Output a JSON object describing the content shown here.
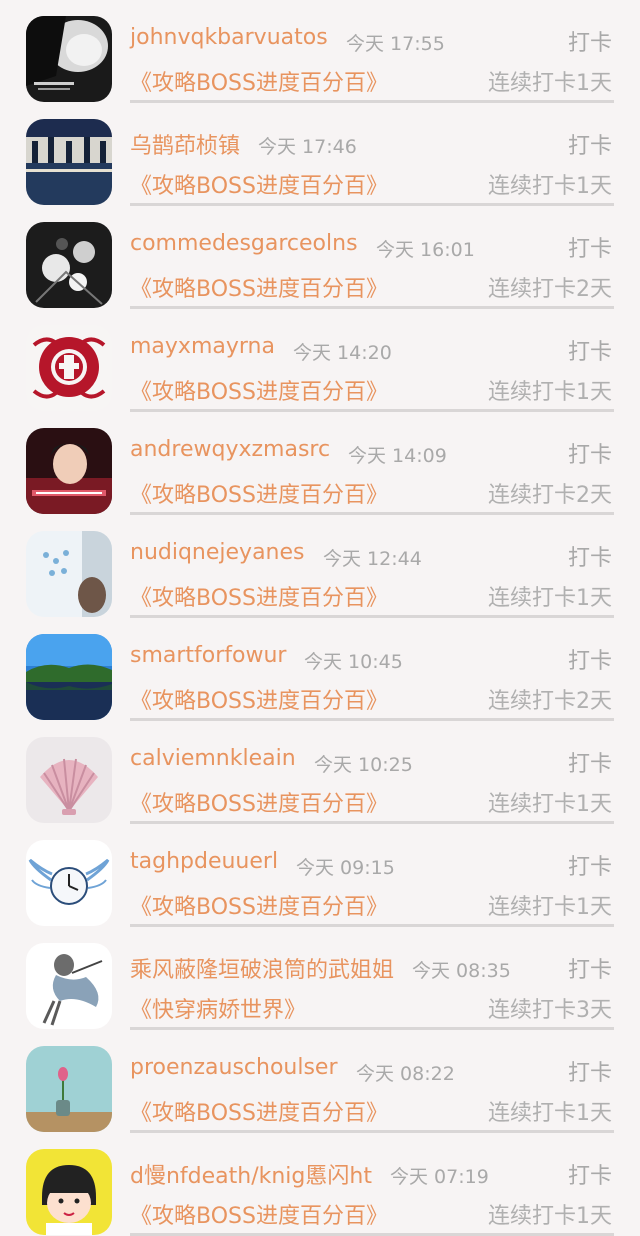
{
  "entries": [
    {
      "username": "johnvqkbarvuatos",
      "time": "今天 17:55",
      "action": "打卡",
      "book": "《攻略BOSS进度百分百》",
      "streak": "连续打卡1天",
      "avatar": "bw-portrait"
    },
    {
      "username": "乌鹊茚桢镇",
      "time": "今天 17:46",
      "action": "打卡",
      "book": "《攻略BOSS进度百分百》",
      "streak": "连续打卡1天",
      "avatar": "dancers"
    },
    {
      "username": "commedesgarceolns",
      "time": "今天 16:01",
      "action": "打卡",
      "book": "《攻略BOSS进度百分百》",
      "streak": "连续打卡2天",
      "avatar": "dark-flowers"
    },
    {
      "username": "mayxmayrna",
      "time": "今天 14:20",
      "action": "打卡",
      "book": "《攻略BOSS进度百分百》",
      "streak": "连续打卡1天",
      "avatar": "fu-papercut"
    },
    {
      "username": "andrewqyxzmasrc",
      "time": "今天 14:09",
      "action": "打卡",
      "book": "《攻略BOSS进度百分百》",
      "streak": "连续打卡2天",
      "avatar": "red-portrait"
    },
    {
      "username": "nudiqnejeyanes",
      "time": "今天 12:44",
      "action": "打卡",
      "book": "《攻略BOSS进度百分百》",
      "streak": "连续打卡1天",
      "avatar": "pale-illustration"
    },
    {
      "username": "smartforfowur",
      "time": "今天 10:45",
      "action": "打卡",
      "book": "《攻略BOSS进度百分百》",
      "streak": "连续打卡2天",
      "avatar": "lake"
    },
    {
      "username": "calviemnkleain",
      "time": "今天 10:25",
      "action": "打卡",
      "book": "《攻略BOSS进度百分百》",
      "streak": "连续打卡1天",
      "avatar": "seashell"
    },
    {
      "username": "taghpdeuuerl",
      "time": "今天 09:15",
      "action": "打卡",
      "book": "《攻略BOSS进度百分百》",
      "streak": "连续打卡1天",
      "avatar": "winged-clock"
    },
    {
      "username": "乘风蔽隆垣破浪筒的武姐姐",
      "time": "今天 08:35",
      "action": "打卡",
      "book": "《快穿病娇世界》",
      "streak": "连续打卡3天",
      "avatar": "flying-girl"
    },
    {
      "username": "proenzauschoulser",
      "time": "今天 08:22",
      "action": "打卡",
      "book": "《攻略BOSS进度百分百》",
      "streak": "连续打卡1天",
      "avatar": "tulip-vase"
    },
    {
      "username": "d慢nfdeath/knig慝闪ht",
      "time": "今天 07:19",
      "action": "打卡",
      "book": "《攻略BOSS进度百分百》",
      "streak": "连续打卡1天",
      "avatar": "cartoon-girl"
    }
  ],
  "colors": {
    "accent": "#e8945f",
    "muted": "#a9a9a9",
    "background": "#f7f4f4",
    "divider": "#d9d6d6"
  }
}
